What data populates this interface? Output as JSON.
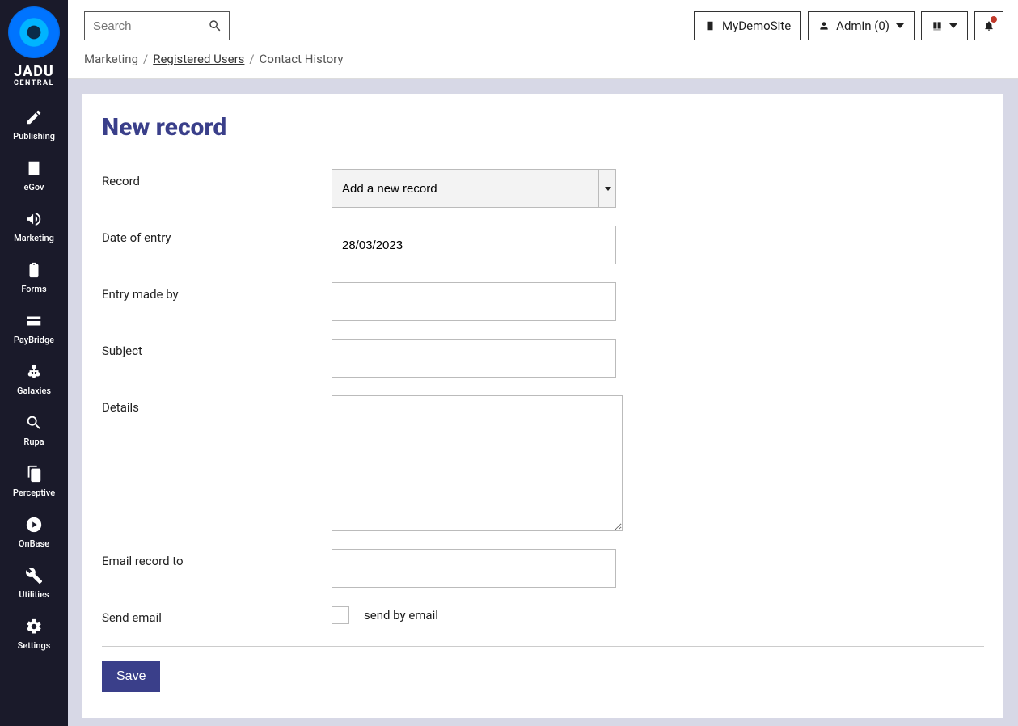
{
  "brand": {
    "line1": "JADU",
    "line2": "CENTRAL"
  },
  "sidebar": {
    "items": [
      {
        "label": "Publishing"
      },
      {
        "label": "eGov"
      },
      {
        "label": "Marketing"
      },
      {
        "label": "Forms"
      },
      {
        "label": "PayBridge"
      },
      {
        "label": "Galaxies"
      },
      {
        "label": "Rupa"
      },
      {
        "label": "Perceptive"
      },
      {
        "label": "OnBase"
      },
      {
        "label": "Utilities"
      },
      {
        "label": "Settings"
      }
    ]
  },
  "header": {
    "search_placeholder": "Search",
    "site_name": "MyDemoSite",
    "user_label": "Admin (0)"
  },
  "breadcrumb": {
    "items": [
      {
        "text": "Marketing",
        "link": false
      },
      {
        "text": "Registered Users",
        "link": true
      },
      {
        "text": "Contact History",
        "link": false
      }
    ]
  },
  "page": {
    "title": "New record",
    "fields": {
      "record_label": "Record",
      "record_selected": "Add a new record",
      "date_label": "Date of entry",
      "date_value": "28/03/2023",
      "entry_label": "Entry made by",
      "entry_value": "",
      "subject_label": "Subject",
      "subject_value": "",
      "details_label": "Details",
      "details_value": "",
      "email_to_label": "Email record to",
      "email_to_value": "",
      "send_email_label": "Send email",
      "send_email_checkbox_label": "send by email"
    },
    "actions": {
      "save": "Save"
    }
  }
}
